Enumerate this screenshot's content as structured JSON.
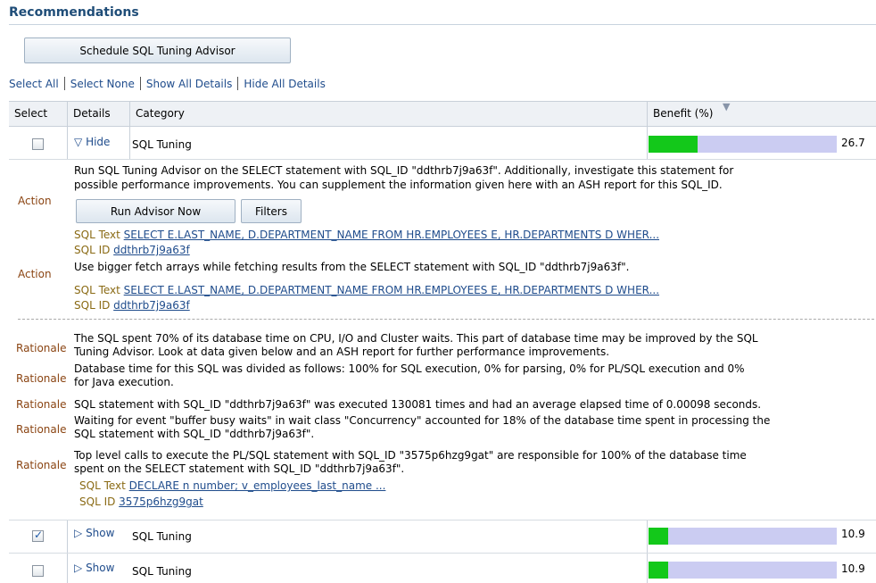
{
  "section_title": "Recommendations",
  "schedule_button": "Schedule SQL Tuning Advisor",
  "links": [
    "Select All",
    "Select None",
    "Show All Details",
    "Hide All Details"
  ],
  "columns": {
    "select": "Select",
    "details": "Details",
    "category": "Category",
    "benefit": "Benefit (%)"
  },
  "rows": [
    {
      "checked": false,
      "toggle": "Hide",
      "category": "SQL Tuning",
      "benefit": "26.7",
      "benefit_pct": 26.7
    },
    {
      "checked": true,
      "toggle": "Show",
      "category": "SQL Tuning",
      "benefit": "10.9",
      "benefit_pct": 10.9
    },
    {
      "checked": false,
      "toggle": "Show",
      "category": "SQL Tuning",
      "benefit": "10.9",
      "benefit_pct": 10.9
    }
  ],
  "expanded_arrow": "▽",
  "collapsed_arrow": "▷",
  "sort_arrow": "▼",
  "detail": {
    "action_label": "Action",
    "rationale_label": "Rationale",
    "action1_line1": "Run SQL Tuning Advisor on the SELECT statement with SQL_ID \"ddthrb7j9a63f\". Additionally, investigate this statement for",
    "action1_line2": "possible performance improvements. You can supplement the information given here with an ASH report for this SQL_ID.",
    "run_advisor_button": "Run Advisor Now",
    "filters_button": "Filters",
    "sql_text_label": "SQL Text",
    "sql_id_label": "SQL ID",
    "sql_text_1": "SELECT E.LAST_NAME, D.DEPARTMENT_NAME FROM HR.EMPLOYEES E, HR.DEPARTMENTS D WHER...",
    "sql_id_1": "ddthrb7j9a63f",
    "action2_line1": "Use bigger fetch arrays while fetching results from the SELECT statement with SQL_ID \"ddthrb7j9a63f\".",
    "sql_text_2": "SELECT E.LAST_NAME, D.DEPARTMENT_NAME FROM HR.EMPLOYEES E, HR.DEPARTMENTS D WHER...",
    "sql_id_2": "ddthrb7j9a63f",
    "rationale1_line1": "The SQL spent 70% of its database time on CPU, I/O and Cluster waits. This part of database time may be improved by the SQL",
    "rationale1_line2": "Tuning Advisor. Look at data given below and an ASH report for further performance improvements.",
    "rationale2_line1": "Database time for this SQL was divided as follows: 100% for SQL execution, 0% for parsing, 0% for PL/SQL execution and 0%",
    "rationale2_line2": "for Java execution.",
    "rationale3_line1": "SQL statement with SQL_ID \"ddthrb7j9a63f\" was executed 130081 times and had an average elapsed time of 0.00098 seconds.",
    "rationale4_line1": "Waiting for event \"buffer busy waits\" in wait class \"Concurrency\" accounted for 18% of the database time spent in processing the",
    "rationale4_line2": "SQL statement with SQL_ID \"ddthrb7j9a63f\".",
    "rationale5_line1": "Top level calls to execute the PL/SQL statement with SQL_ID \"3575p6hzg9gat\" are responsible for 100% of the database time",
    "rationale5_line2": "spent on the SELECT statement with SQL_ID \"ddthrb7j9a63f\".",
    "sql_text_3": "DECLARE n number; v_employees_last_name ...",
    "sql_id_3": "3575p6hzg9gat"
  }
}
